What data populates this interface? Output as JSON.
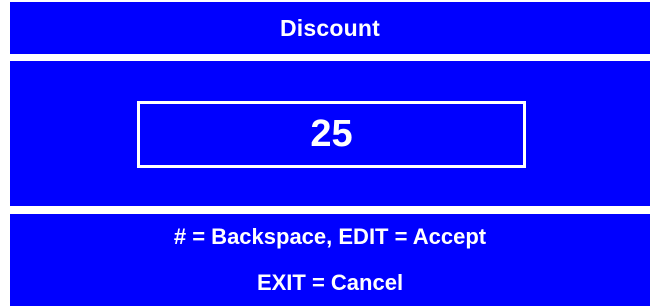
{
  "screen": {
    "title": "Discount",
    "value": "25",
    "instructions": {
      "line1": "# = Backspace, EDIT = Accept",
      "line2": "EXIT = Cancel"
    }
  },
  "colors": {
    "panel_background": "#0000ff",
    "text": "#ffffff",
    "page_background": "#ffffff"
  }
}
